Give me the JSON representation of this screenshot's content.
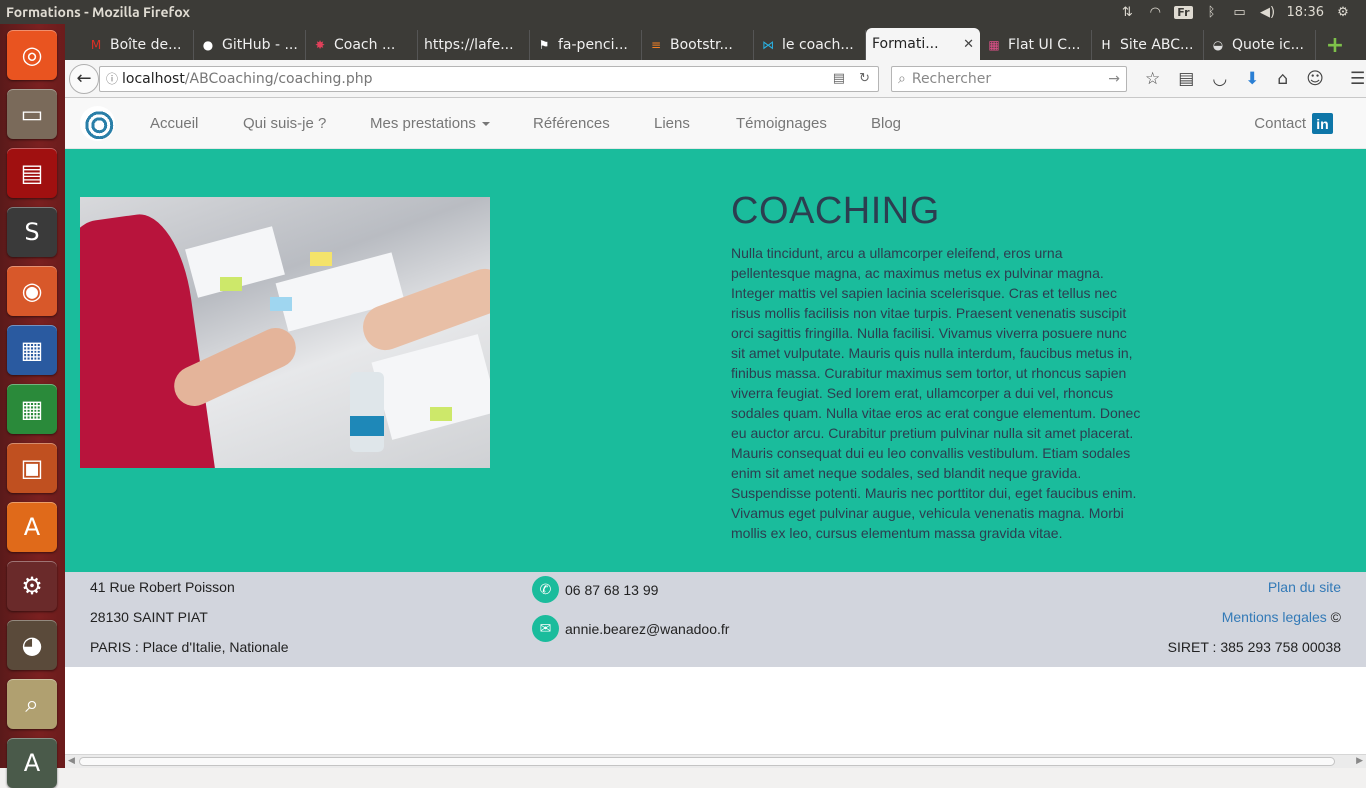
{
  "window": {
    "title": "Formations - Mozilla Firefox"
  },
  "tray": {
    "keyboard": "Fr",
    "time": "18:36"
  },
  "launcher": [
    {
      "name": "ubuntu-dash-icon",
      "color": "#e95420",
      "glyph": "◎"
    },
    {
      "name": "files-icon",
      "color": "#7a6a5a",
      "glyph": "▭"
    },
    {
      "name": "terminal-icon",
      "color": "#a01010",
      "glyph": "▤"
    },
    {
      "name": "sublime-text-icon",
      "color": "#3a3a3a",
      "glyph": "S"
    },
    {
      "name": "firefox-icon",
      "color": "#d8582a",
      "glyph": "◉"
    },
    {
      "name": "libreoffice-writer-icon",
      "color": "#2a5aa0",
      "glyph": "▦"
    },
    {
      "name": "libreoffice-calc-icon",
      "color": "#2a8a3a",
      "glyph": "▦"
    },
    {
      "name": "libreoffice-impress-icon",
      "color": "#c05020",
      "glyph": "▣"
    },
    {
      "name": "ubuntu-software-icon",
      "color": "#e06a1a",
      "glyph": "A"
    },
    {
      "name": "system-settings-icon",
      "color": "#6a2a2a",
      "glyph": "⚙"
    },
    {
      "name": "gimp-icon",
      "color": "#5a4a3a",
      "glyph": "◕"
    },
    {
      "name": "image-viewer-icon",
      "color": "#b0a070",
      "glyph": "⌕"
    },
    {
      "name": "update-manager-icon",
      "color": "#4a5a4a",
      "glyph": "A"
    }
  ],
  "tabs": [
    {
      "label": "Boîte de...",
      "icon": "gmail-icon",
      "fav": "M",
      "favColor": "#d93025"
    },
    {
      "label": "GitHub - ...",
      "icon": "github-icon",
      "fav": "●",
      "favColor": "#ffffff"
    },
    {
      "label": "Coach ...",
      "icon": "star-icon",
      "fav": "✸",
      "favColor": "#e0405a"
    },
    {
      "label": "https://lafe...",
      "icon": "",
      "fav": "",
      "favColor": ""
    },
    {
      "label": "fa-penci...",
      "icon": "flag-icon",
      "fav": "⚑",
      "favColor": "#ffffff"
    },
    {
      "label": "Bootstr...",
      "icon": "stackoverflow-icon",
      "fav": "≡",
      "favColor": "#f48024"
    },
    {
      "label": "le coach...",
      "icon": "bowtie-icon",
      "fav": "⋈",
      "favColor": "#2ab0e0"
    },
    {
      "label": "Formati...",
      "icon": "",
      "fav": "",
      "favColor": "",
      "active": true
    },
    {
      "label": "Flat UI C...",
      "icon": "flatui-icon",
      "fav": "▦",
      "favColor": "#e0508a"
    },
    {
      "label": "Site ABC...",
      "icon": "h-icon",
      "fav": "H",
      "favColor": "#ffffff"
    },
    {
      "label": "Quote ic...",
      "icon": "quote-icon",
      "fav": "◒",
      "favColor": "#dddddd"
    }
  ],
  "url": {
    "host": "localhost",
    "path": "/ABCoaching/coaching.php"
  },
  "search": {
    "placeholder": "Rechercher"
  },
  "site": {
    "nav": [
      {
        "label": "Accueil",
        "name": "nav-accueil"
      },
      {
        "label": "Qui suis-je ?",
        "name": "nav-qui-suis-je"
      },
      {
        "label": "Mes prestations",
        "name": "nav-mes-prestations",
        "dropdown": true
      },
      {
        "label": "Références",
        "name": "nav-references"
      },
      {
        "label": "Liens",
        "name": "nav-liens"
      },
      {
        "label": "Témoignages",
        "name": "nav-temoignages"
      },
      {
        "label": "Blog",
        "name": "nav-blog"
      }
    ],
    "contact": "Contact",
    "linkedin": "in",
    "heading": "COACHING",
    "body": "Nulla tincidunt, arcu a ullamcorper eleifend, eros urna pellentesque magna, ac maximus metus ex pulvinar magna. Integer mattis vel sapien lacinia scelerisque. Cras et tellus nec risus mollis facilisis non vitae turpis. Praesent venenatis suscipit orci sagittis fringilla. Nulla facilisi. Vivamus viverra posuere nunc sit amet vulputate. Mauris quis nulla interdum, faucibus metus in, finibus massa. Curabitur maximus sem tortor, ut rhoncus sapien viverra feugiat. Sed lorem erat, ullamcorper a dui vel, rhoncus sodales quam. Nulla vitae eros ac erat congue elementum. Donec eu auctor arcu. Curabitur pretium pulvinar nulla sit amet placerat. Mauris consequat dui eu leo convallis vestibulum. Etiam sodales enim sit amet neque sodales, sed blandit neque gravida. Suspendisse potenti. Mauris nec porttitor dui, eget faucibus enim. Vivamus eget pulvinar augue, vehicula venenatis magna. Morbi mollis ex leo, cursus elementum massa gravida vitae."
  },
  "footer": {
    "address1": "41 Rue Robert Poisson",
    "address2": "28130 SAINT PIAT",
    "address3": "PARIS : Place d'Italie, Nationale",
    "phone": "06 87 68 13 99",
    "email": "annie.bearez@wanadoo.fr",
    "plan": "Plan du site",
    "mentions": "Mentions legales",
    "copyright": "©",
    "siret": "SIRET : 385 293 758 00038"
  },
  "colors": {
    "hero": "#1abc9c",
    "footer": "#d2d5dd",
    "link": "#337ab7"
  }
}
